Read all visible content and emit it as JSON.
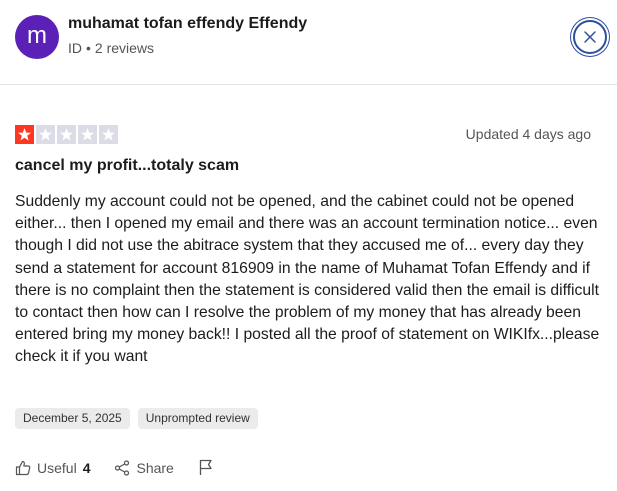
{
  "reviewer": {
    "avatar_letter": "m",
    "name": "muhamat tofan effendy Effendy",
    "country": "ID",
    "reviews": "2 reviews"
  },
  "review": {
    "rating": 1,
    "max_rating": 5,
    "updated": "Updated 4 days ago",
    "title": "cancel my profit...totaly scam",
    "body": "Suddenly my account could not be opened, and the cabinet could not be opened either... then I opened my email and there was an account termination notice... even though I did not use the abitrace system that they accused me of... every day they send a statement for account 816909 in the name of Muhamat Tofan Effendy and if there is no complaint then the statement is considered valid then the email is difficult to contact then how can I resolve the problem of my money that has already been entered bring my money back!! I posted all the proof of statement on WIKIfx...please check it if you want",
    "tags": [
      "December 5, 2025",
      "Unprompted review"
    ]
  },
  "actions": {
    "useful_label": "Useful",
    "useful_count": "4",
    "share_label": "Share"
  },
  "colors": {
    "avatar": "#5b21b6",
    "star_filled": "#ff3722",
    "star_empty": "#dcdce6",
    "close_ring": "#2f4f9c"
  },
  "icons": {
    "close": "close-icon",
    "star": "star-icon",
    "useful": "thumbs-up-icon",
    "share": "share-icon",
    "flag": "flag-icon"
  }
}
